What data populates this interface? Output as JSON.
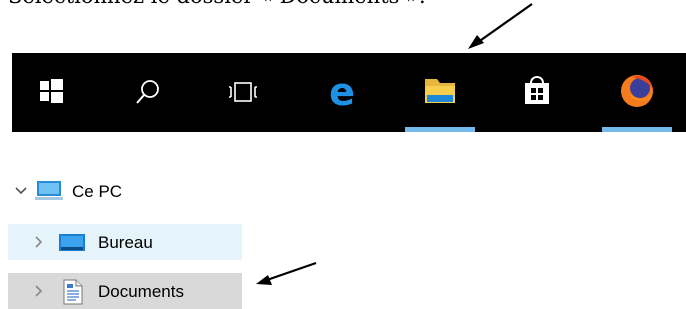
{
  "instruction": "Sélectionnez le dossier « Documents ».",
  "taskbar": {
    "items": [
      {
        "icon": "windows-start-icon"
      },
      {
        "icon": "search-icon"
      },
      {
        "icon": "task-view-icon"
      },
      {
        "icon": "edge-icon"
      },
      {
        "icon": "file-explorer-icon"
      },
      {
        "icon": "store-icon"
      },
      {
        "icon": "firefox-icon"
      }
    ],
    "colors": {
      "background": "#000000",
      "indicator": "#76b9ed",
      "edge": "#1e90e5",
      "explorer": "#f3c33c"
    }
  },
  "nav_tree": {
    "root": {
      "label": "Ce PC",
      "icon": "pc-icon",
      "expanded": true
    },
    "items": [
      {
        "label": "Bureau",
        "icon": "desktop-folder-icon",
        "state": "hover",
        "color": "#e5f3fb"
      },
      {
        "label": "Documents",
        "icon": "documents-icon",
        "state": "selected",
        "color": "#d9d9d9"
      }
    ]
  }
}
